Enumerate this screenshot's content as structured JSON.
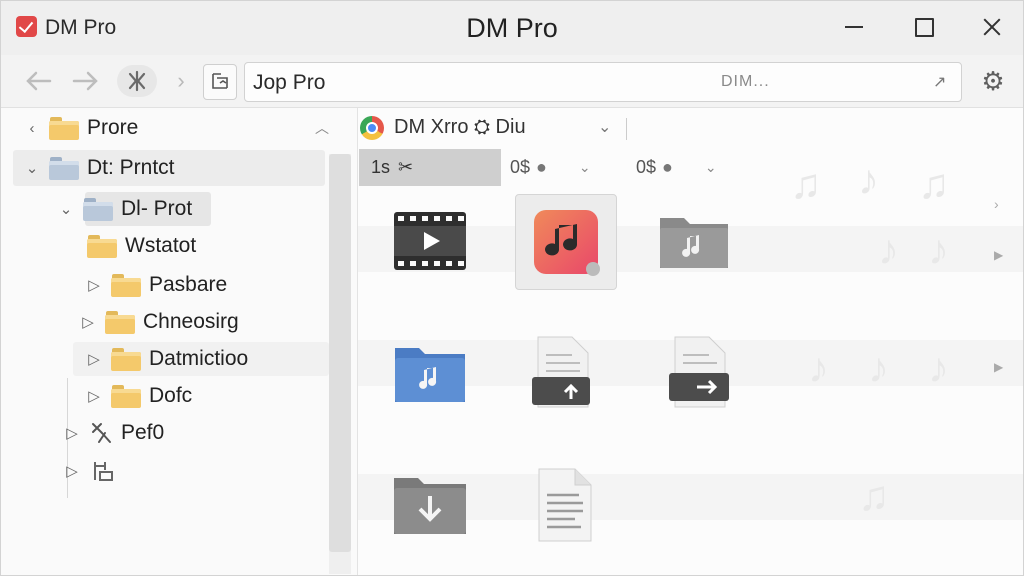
{
  "window": {
    "app_name": "DM Pro",
    "title": "DM Pro"
  },
  "toolbar": {
    "address_value": "Jop Pro",
    "address_hint": "DIM...",
    "address_go": "↗",
    "nav_chevron": "›"
  },
  "tree": {
    "items": [
      {
        "label": "Prore",
        "twisty": "‹",
        "trail": "︿"
      },
      {
        "label": "Dt: Prntct",
        "twisty": "⌄"
      },
      {
        "label": "Dl- Prot",
        "twisty": "⌄"
      },
      {
        "label": "Wstatot"
      },
      {
        "label": "Pasbare",
        "twisty": "▷"
      },
      {
        "label": "Chneosirg",
        "twisty": "▷"
      },
      {
        "label": "Datmictioo",
        "twisty": "▷"
      },
      {
        "label": "Dofc",
        "twisty": "▷"
      },
      {
        "label": "Pef0",
        "twisty": "▷"
      },
      {
        "label": "",
        "twisty": "▷"
      }
    ]
  },
  "main": {
    "title": "DM Xrro ⛭ Diu",
    "columns": [
      {
        "label": "1s"
      },
      {
        "label": "0$"
      },
      {
        "label": "0$"
      }
    ],
    "tiles": [
      {
        "name": "video-clapper-icon"
      },
      {
        "name": "music-app-icon"
      },
      {
        "name": "music-folder-icon"
      },
      {
        "name": "blue-music-folder-icon"
      },
      {
        "name": "document-upload-icon"
      },
      {
        "name": "document-move-icon"
      },
      {
        "name": "download-folder-icon"
      },
      {
        "name": "text-document-icon"
      }
    ]
  },
  "colors": {
    "accent_red": "#e14848",
    "folder_yellow": "#f4c96b",
    "folder_blue": "#b9c8da",
    "selected_header": "#cfcfcf"
  }
}
